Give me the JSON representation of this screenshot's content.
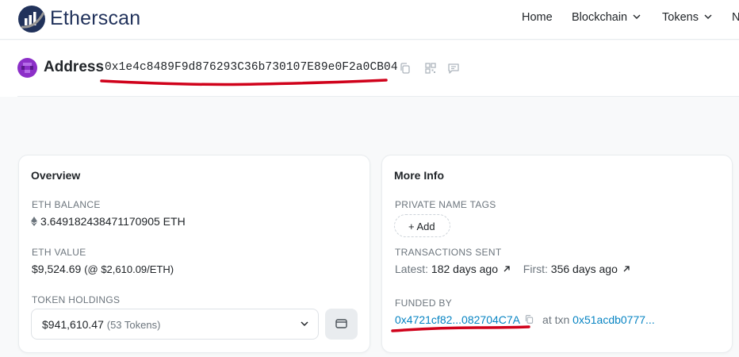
{
  "brand": {
    "name": "Etherscan"
  },
  "nav": {
    "home": "Home",
    "blockchain": "Blockchain",
    "tokens": "Tokens",
    "more": "N"
  },
  "address": {
    "label": "Address",
    "hash": "0x1e4c8489F9d876293C36b730107E89e0F2a0CB04"
  },
  "overview": {
    "title": "Overview",
    "eth_balance_label": "ETH BALANCE",
    "eth_balance_value": "3.649182438471170905 ETH",
    "eth_value_label": "ETH VALUE",
    "eth_value": "$9,524.69",
    "eth_price": "(@ $2,610.09/ETH)",
    "token_holdings_label": "TOKEN HOLDINGS",
    "token_holdings_value": "$941,610.47",
    "token_count": "(53 Tokens)"
  },
  "more_info": {
    "title": "More Info",
    "private_tags_label": "PRIVATE NAME TAGS",
    "add_label": "+ Add",
    "tx_sent_label": "TRANSACTIONS SENT",
    "latest_label": "Latest:",
    "latest_value": "182 days ago",
    "first_label": "First:",
    "first_value": "356 days ago",
    "funded_by_label": "FUNDED BY",
    "funded_by_address": "0x4721cf82...082704C7A",
    "at_txn_label": "at txn",
    "funded_txn": "0x51acdb0777..."
  },
  "colors": {
    "brand": "#21325b",
    "link": "#0784c3",
    "avatar": "#8c2fc8",
    "annotation": "#d0021b"
  },
  "icons": [
    "etherscan-logo",
    "chevron-down-icon",
    "copy-icon",
    "qr-code-icon",
    "comment-icon",
    "ethereum-icon",
    "wallet-icon",
    "external-arrow-icon"
  ]
}
